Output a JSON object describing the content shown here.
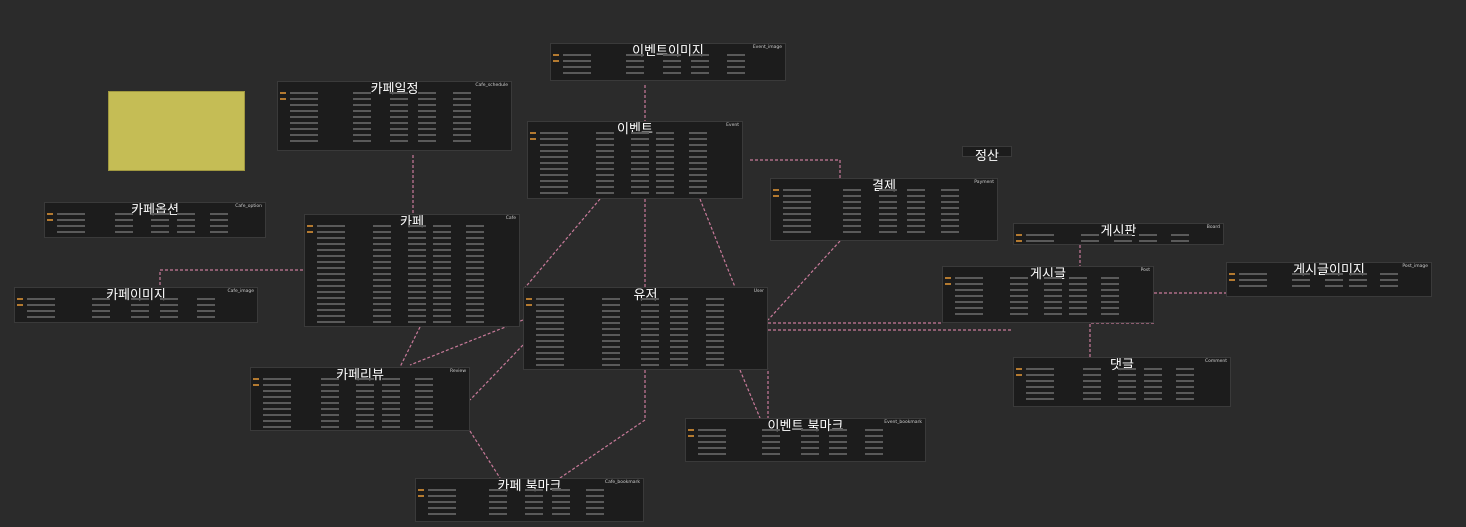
{
  "colors": {
    "background": "#2b2b2b",
    "table": "#1c1c1c",
    "line": "#c87a9a",
    "memo": "#c5bd55"
  },
  "memo": {
    "lines": [
      "",
      "",
      "",
      "",
      "",
      "",
      ""
    ]
  },
  "settlement": {
    "title": "정산"
  },
  "tables": [
    {
      "id": "event-image",
      "title": "이벤트이미지",
      "entity": "Event_image",
      "rows": 4
    },
    {
      "id": "cafe-schedule",
      "title": "카페일정",
      "entity": "Cafe_schedule",
      "rows": 9
    },
    {
      "id": "event",
      "title": "이벤트",
      "entity": "Event",
      "rows": 11
    },
    {
      "id": "payment",
      "title": "결제",
      "entity": "Payment",
      "rows": 8
    },
    {
      "id": "cafe-option",
      "title": "카페옵션",
      "entity": "Cafe_option",
      "rows": 4
    },
    {
      "id": "cafe",
      "title": "카페",
      "entity": "Cafe",
      "rows": 17
    },
    {
      "id": "board",
      "title": "게시판",
      "entity": "Board",
      "rows": 2
    },
    {
      "id": "post",
      "title": "게시글",
      "entity": "Post",
      "rows": 7
    },
    {
      "id": "post-image",
      "title": "게시글이미지",
      "entity": "Post_image",
      "rows": 3
    },
    {
      "id": "cafe-image",
      "title": "카페이미지",
      "entity": "Cafe_image",
      "rows": 4
    },
    {
      "id": "user",
      "title": "유저",
      "entity": "User",
      "rows": 12
    },
    {
      "id": "comment",
      "title": "댓글",
      "entity": "Comment",
      "rows": 6
    },
    {
      "id": "cafe-review",
      "title": "카페리뷰",
      "entity": "Review",
      "rows": 10
    },
    {
      "id": "event-bookmark",
      "title": "이벤트 북마크",
      "entity": "Event_bookmark",
      "rows": 5
    },
    {
      "id": "cafe-bookmark",
      "title": "카페 북마크",
      "entity": "Cafe_bookmark",
      "rows": 5
    }
  ]
}
